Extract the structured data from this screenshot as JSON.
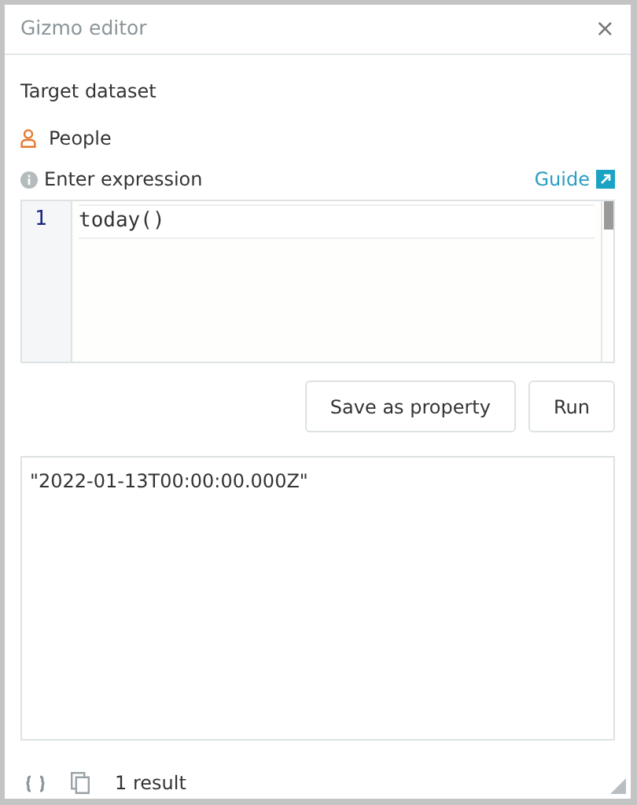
{
  "window": {
    "title": "Gizmo editor",
    "close": "×"
  },
  "target_label": "Target dataset",
  "dataset": "People",
  "expression": {
    "label": "Enter expression",
    "guide": "Guide",
    "lines": [
      {
        "number": "1",
        "code": "today()"
      }
    ]
  },
  "buttons": [
    "Save as property",
    "Run"
  ],
  "result": "\"2022-01-13T00:00:00.000Z\"",
  "footer": {
    "count": "1 result"
  }
}
